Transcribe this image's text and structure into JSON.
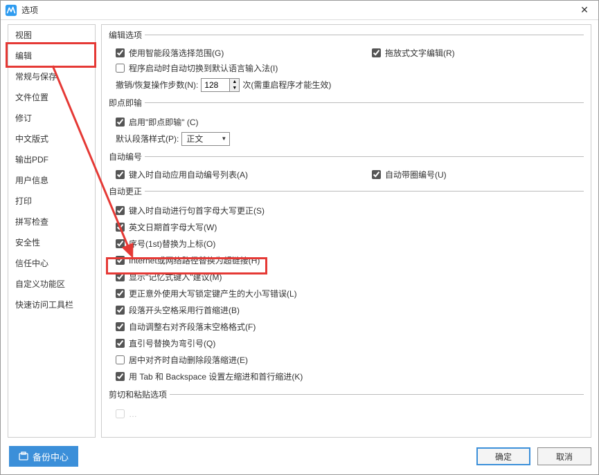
{
  "window": {
    "title": "选项"
  },
  "sidebar": {
    "items": [
      {
        "label": "视图"
      },
      {
        "label": "编辑"
      },
      {
        "label": "常规与保存"
      },
      {
        "label": "文件位置"
      },
      {
        "label": "修订"
      },
      {
        "label": "中文版式"
      },
      {
        "label": "输出PDF"
      },
      {
        "label": "用户信息"
      },
      {
        "label": "打印"
      },
      {
        "label": "拼写检查"
      },
      {
        "label": "安全性"
      },
      {
        "label": "信任中心"
      },
      {
        "label": "自定义功能区"
      },
      {
        "label": "快速访问工具栏"
      }
    ],
    "selected_index": 1
  },
  "sections": {
    "edit_options": {
      "legend": "编辑选项",
      "smart_paragraph": "使用智能段落选择范围(G)",
      "drag_drop_edit": "拖放式文字编辑(R)",
      "auto_switch_ime": "程序启动时自动切换到默认语言输入法(I)",
      "undo_label_left": "撤销/恢复操作步数(N):",
      "undo_value": "128",
      "undo_label_right": "次(需重启程序才能生效)"
    },
    "click_type": {
      "legend": "即点即输",
      "enable_click_type": "启用\"即点即输\" (C)",
      "default_para_style_label": "默认段落样式(P):",
      "default_para_style_value": "正文"
    },
    "auto_number": {
      "legend": "自动编号",
      "apply_auto_list": "键入时自动应用自动编号列表(A)",
      "auto_circled_number": "自动带圈编号(U)"
    },
    "auto_correct": {
      "legend": "自动更正",
      "items": [
        {
          "label": "键入时自动进行句首字母大写更正(S)",
          "checked": true
        },
        {
          "label": "英文日期首字母大写(W)",
          "checked": true
        },
        {
          "label": "序号(1st)替换为上标(O)",
          "checked": true
        },
        {
          "label": "Internet或网络路径替换为超链接(H)",
          "checked": true
        },
        {
          "label": "显示\"记忆式键入\"建议(M)",
          "checked": true
        },
        {
          "label": "更正意外使用大写锁定键产生的大小写错误(L)",
          "checked": true
        },
        {
          "label": "段落开头空格采用行首缩进(B)",
          "checked": true
        },
        {
          "label": "自动调整右对齐段落末空格格式(F)",
          "checked": true
        },
        {
          "label": "直引号替换为弯引号(Q)",
          "checked": true
        },
        {
          "label": "居中对齐时自动删除段落缩进(E)",
          "checked": false
        },
        {
          "label": "用 Tab 和 Backspace 设置左缩进和首行缩进(K)",
          "checked": true
        }
      ]
    },
    "cut_paste": {
      "legend": "剪切和粘贴选项"
    }
  },
  "footer": {
    "backup": "备份中心",
    "ok": "确定",
    "cancel": "取消"
  }
}
